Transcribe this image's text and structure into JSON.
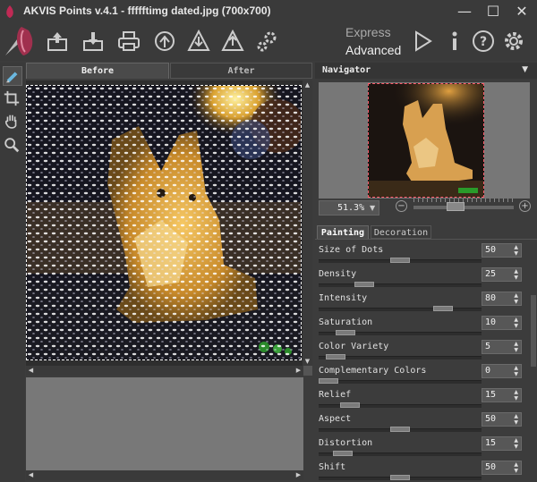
{
  "window": {
    "title": "AKVIS Points v.4.1 - ffffftimg dated.jpg (700x700)",
    "minimize_glyph": "—",
    "maximize_glyph": "☐",
    "close_glyph": "✕"
  },
  "toolbar": {
    "icons": [
      "open-image-icon",
      "save-image-icon",
      "print-icon",
      "share-icon",
      "presets-import-icon",
      "presets-export-icon",
      "batch-settings-icon",
      "run-icon",
      "info-icon",
      "help-icon",
      "preferences-icon"
    ],
    "mode_express": "Express",
    "mode_advanced": "Advanced"
  },
  "tools": [
    "brush-tool-icon",
    "crop-tool-icon",
    "hand-tool-icon",
    "zoom-tool-icon"
  ],
  "image_tabs": {
    "before": "Before",
    "after": "After"
  },
  "navigator": {
    "title": "Navigator",
    "zoom_value": "51.3%",
    "zoom_minus": "−",
    "zoom_plus": "+",
    "zoom_level_fraction": 0.4
  },
  "settings_tabs": {
    "painting": "Painting",
    "decoration": "Decoration"
  },
  "parameters": [
    {
      "label": "Size of Dots",
      "value": "50",
      "level": 0.5
    },
    {
      "label": "Density",
      "value": "25",
      "level": 0.25
    },
    {
      "label": "Intensity",
      "value": "80",
      "level": 0.8
    },
    {
      "label": "Saturation",
      "value": "10",
      "level": 0.12
    },
    {
      "label": "Color Variety",
      "value": "5",
      "level": 0.05
    },
    {
      "label": "Complementary Colors",
      "value": "0",
      "level": 0.0
    },
    {
      "label": "Relief",
      "value": "15",
      "level": 0.15
    },
    {
      "label": "Aspect",
      "value": "50",
      "level": 0.5
    },
    {
      "label": "Distortion",
      "value": "15",
      "level": 0.1
    },
    {
      "label": "Shift",
      "value": "50",
      "level": 0.5
    }
  ],
  "colors": {
    "background": "#3c3c3c",
    "panel": "#3a3a3a",
    "navigator_selection": "#ff5a6a"
  }
}
